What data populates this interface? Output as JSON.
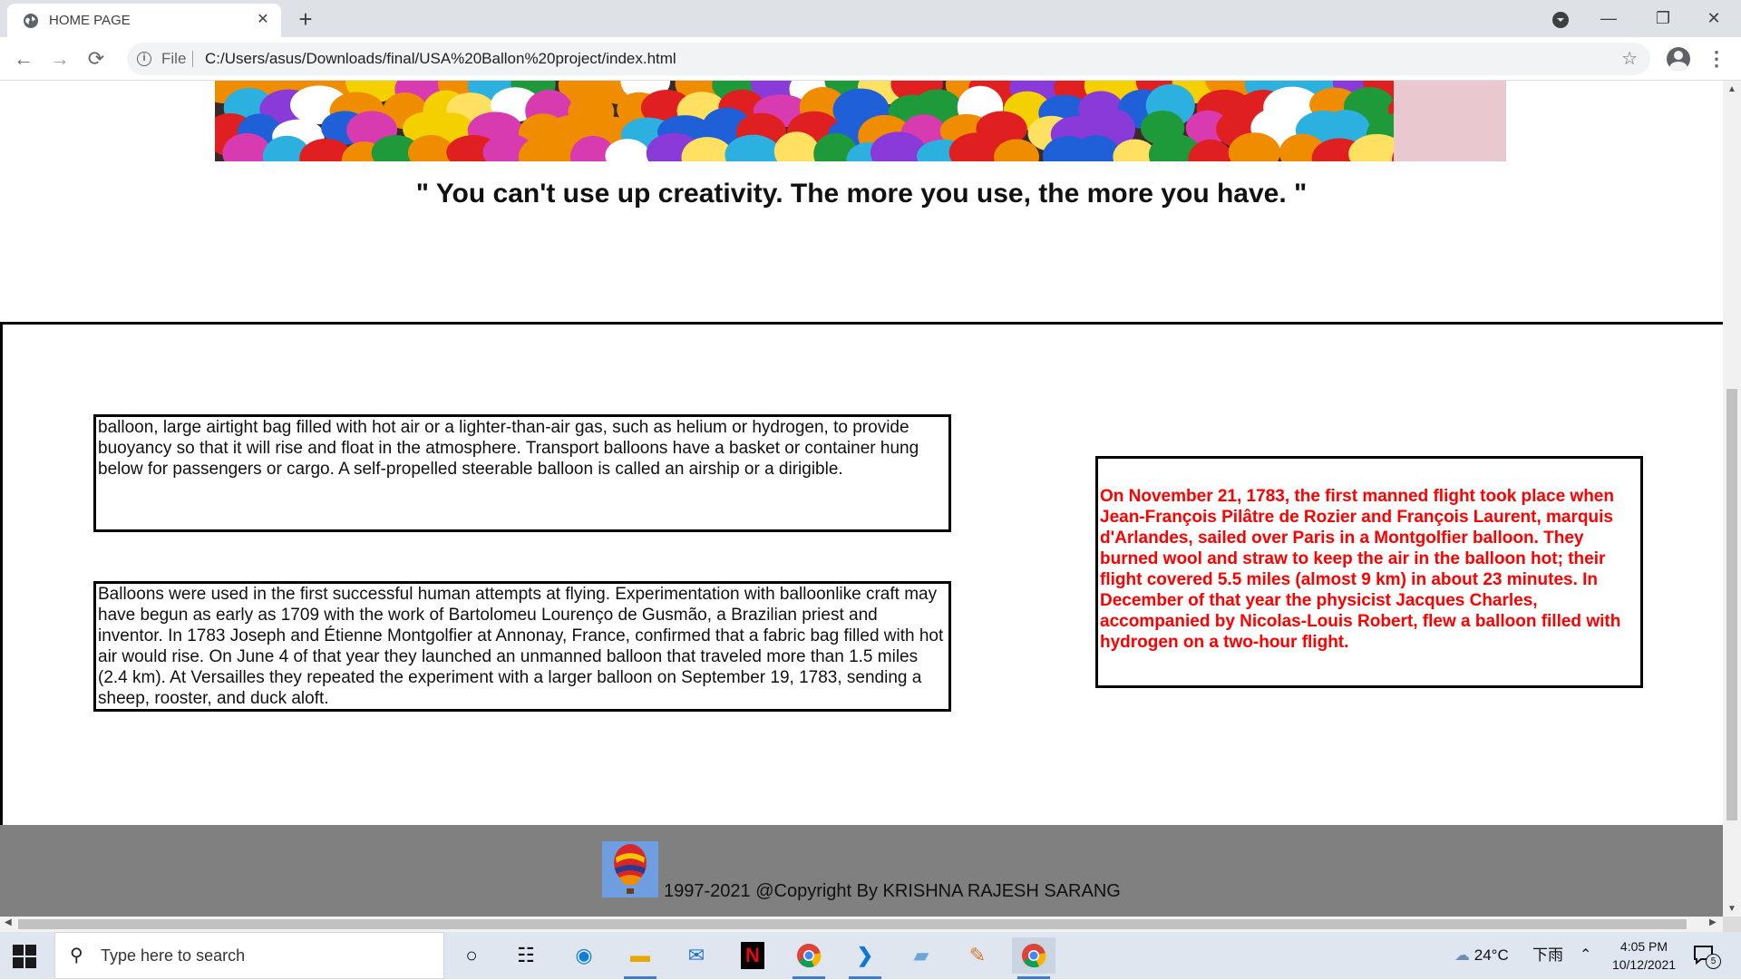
{
  "browser": {
    "tab_title": "HOME PAGE",
    "tab_close": "✕",
    "new_tab": "+",
    "url_scheme": "File",
    "url": "C:/Users/asus/Downloads/final/USA%20Ballon%20project/index.html",
    "window_controls": {
      "minimize": "—",
      "maximize": "❐",
      "close": "✕"
    },
    "nav": {
      "back": "←",
      "forward": "→",
      "reload": "⟳"
    },
    "menu": "⋮",
    "star": "☆",
    "info": "i"
  },
  "page": {
    "quote": "\" You can't use up creativity. The more you use, the more you have. \"",
    "box1_text": "balloon, large airtight bag filled with hot air or a lighter-than-air gas, such as helium or hydrogen, to provide buoyancy so that it will rise and float in the atmosphere. Transport balloons have a basket or container hung below for passengers or cargo. A self-propelled steerable balloon is called an airship or a dirigible.",
    "box2_text": "Balloons were used in the first successful human attempts at flying. Experimentation with balloonlike craft may have begun as early as 1709 with the work of Bartolomeu Lourenço de Gusmão, a Brazilian priest and inventor. In 1783 Joseph and Étienne Montgolfier at Annonay, France, confirmed that a fabric bag filled with hot air would rise. On June 4 of that year they launched an unmanned balloon that traveled more than 1.5 miles (2.4 km). At Versailles they repeated the experiment with a larger balloon on September 19, 1783, sending a sheep, rooster, and duck aloft.",
    "box3_text": "On November 21, 1783, the first manned flight took place when Jean-François Pilâtre de Rozier and François Laurent, marquis d'Arlandes, sailed over Paris in a Montgolfier balloon. They burned wool and straw to keep the air in the balloon hot; their flight covered 5.5 miles (almost 9 km) in about 23 minutes. In December of that year the physicist Jacques Charles, accompanied by Nicolas-Louis Robert, flew a balloon filled with hydrogen on a two-hour flight.",
    "box3_color": "#ff0000",
    "footer_text": "1997-2021 @Copyright By KRISHNA RAJESH SARANG",
    "footer_bg": "#808080"
  },
  "taskbar": {
    "search_placeholder": "Type here to search",
    "weather": "24°C",
    "ime": "下雨",
    "time": "4:05 PM",
    "date": "10/12/2021",
    "notification_count": "5",
    "apps": [
      "task-view",
      "widgets",
      "edge",
      "file-explorer",
      "mail",
      "netflix",
      "chrome",
      "vscode",
      "notepad",
      "paint",
      "chrome-active"
    ]
  }
}
